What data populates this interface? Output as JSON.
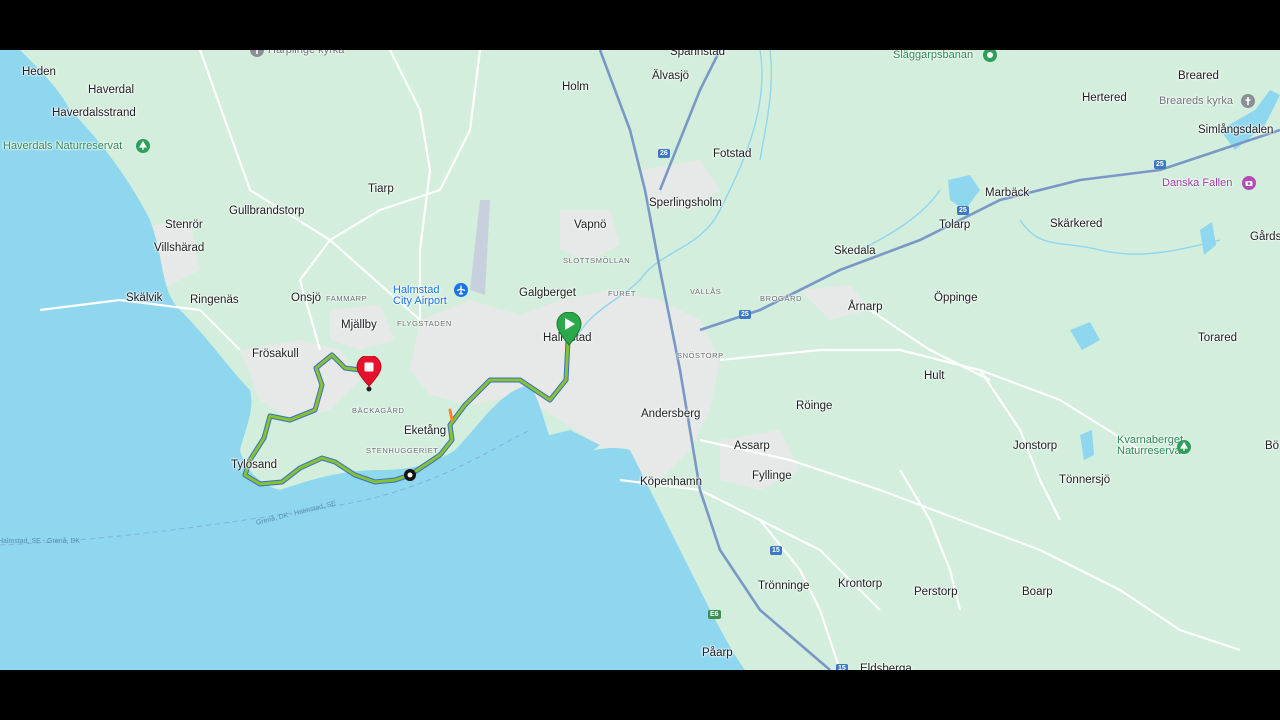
{
  "map": {
    "places": [
      {
        "id": "heden",
        "text": "Heden"
      },
      {
        "id": "haverdal",
        "text": "Haverdal"
      },
      {
        "id": "haverdalsstrand",
        "text": "Haverdalsstrand"
      },
      {
        "id": "tiarp",
        "text": "Tiarp"
      },
      {
        "id": "gullbrandstorp",
        "text": "Gullbrandstorp"
      },
      {
        "id": "stenror",
        "text": "Stenrör"
      },
      {
        "id": "villsharad",
        "text": "Villshärad"
      },
      {
        "id": "skalvik",
        "text": "Skälvik"
      },
      {
        "id": "ringenas",
        "text": "Ringenäs"
      },
      {
        "id": "onsjo",
        "text": "Onsjö"
      },
      {
        "id": "mjallby",
        "text": "Mjällby"
      },
      {
        "id": "frosakull",
        "text": "Frösakull"
      },
      {
        "id": "tylosand",
        "text": "Tylösand"
      },
      {
        "id": "eketang",
        "text": "Eketång"
      },
      {
        "id": "holm",
        "text": "Holm"
      },
      {
        "id": "alvasjo",
        "text": "Älvasjö"
      },
      {
        "id": "spannstad",
        "text": "Spannstad"
      },
      {
        "id": "fotstad",
        "text": "Fotstad"
      },
      {
        "id": "sperlingsholm",
        "text": "Sperlingsholm"
      },
      {
        "id": "vapno",
        "text": "Vapnö"
      },
      {
        "id": "galgberget",
        "text": "Galgberget"
      },
      {
        "id": "halmstad",
        "text": "Halmstad"
      },
      {
        "id": "andersberg",
        "text": "Andersberg"
      },
      {
        "id": "assarp",
        "text": "Assarp"
      },
      {
        "id": "fyllinge",
        "text": "Fyllinge"
      },
      {
        "id": "kopenhamn",
        "text": "Köpenhamn"
      },
      {
        "id": "roinge",
        "text": "Röinge"
      },
      {
        "id": "arnarp",
        "text": "Årnarp"
      },
      {
        "id": "skedala",
        "text": "Skedala"
      },
      {
        "id": "tolarp",
        "text": "Tolarp"
      },
      {
        "id": "marback",
        "text": "Marbäck"
      },
      {
        "id": "skarkered",
        "text": "Skärkered"
      },
      {
        "id": "oppinge",
        "text": "Öppinge"
      },
      {
        "id": "hult",
        "text": "Hult"
      },
      {
        "id": "torared",
        "text": "Torared"
      },
      {
        "id": "jonstorp",
        "text": "Jonstorp"
      },
      {
        "id": "tonnersjo",
        "text": "Tönnersjö"
      },
      {
        "id": "boarp",
        "text": "Boarp"
      },
      {
        "id": "perstorp",
        "text": "Perstorp"
      },
      {
        "id": "krontorp",
        "text": "Krontorp"
      },
      {
        "id": "tronninge",
        "text": "Trönninge"
      },
      {
        "id": "paarp",
        "text": "Påarp"
      },
      {
        "id": "eldsberga",
        "text": "Eldsberga"
      },
      {
        "id": "breared",
        "text": "Breared"
      },
      {
        "id": "hertered",
        "text": "Hertered"
      },
      {
        "id": "simlangsdalen",
        "text": "Simlångsdalen"
      },
      {
        "id": "gards",
        "text": "Gårds"
      },
      {
        "id": "bo",
        "text": "Bö"
      }
    ],
    "districts": [
      {
        "id": "fammarp",
        "text": "FAMMARP"
      },
      {
        "id": "flygstaden",
        "text": "FLYGSTADEN"
      },
      {
        "id": "slottsmollan",
        "text": "SLOTTSMÖLLAN"
      },
      {
        "id": "furet",
        "text": "FURET"
      },
      {
        "id": "vallas",
        "text": "VALLÅS"
      },
      {
        "id": "brogard",
        "text": "BROGÅRD"
      },
      {
        "id": "snostorp",
        "text": "SNÖSTORP"
      },
      {
        "id": "backagard",
        "text": "BÄCKAGÅRD"
      },
      {
        "id": "stenhuggeriet",
        "text": "STENHUGGERIET"
      }
    ],
    "pois": [
      {
        "id": "harplinge",
        "text": "Harplinge kyrka",
        "icon": "church-icon"
      },
      {
        "id": "haverdals-nr",
        "text": "Haverdals Naturreservat",
        "icon": "tree-icon"
      },
      {
        "id": "airport",
        "text": "Halmstad\nCity Airport",
        "icon": "airplane-icon"
      },
      {
        "id": "slaggarp",
        "text": "Släggarpsbanan",
        "icon": "sports-icon"
      },
      {
        "id": "breareds-kyrka",
        "text": "Breareds kyrka",
        "icon": "church-icon"
      },
      {
        "id": "danska-fallen",
        "text": "Danska Fallen",
        "icon": "camera-icon"
      },
      {
        "id": "kvarnaberget",
        "text": "Kvarnaberget\nNaturreservat",
        "icon": "tree-icon"
      }
    ],
    "roads": [
      {
        "id": "r26a",
        "text": "26"
      },
      {
        "id": "r25a",
        "text": "25"
      },
      {
        "id": "r25b",
        "text": "25"
      },
      {
        "id": "r25c",
        "text": "25"
      },
      {
        "id": "r15",
        "text": "15"
      },
      {
        "id": "e6",
        "text": "E6"
      },
      {
        "id": "r15b",
        "text": "15"
      }
    ],
    "ferry": [
      {
        "id": "ferry1",
        "text": "Grenå, DK - Halmstad, SE"
      },
      {
        "id": "ferry2",
        "text": "Halmstad, SE - Grenå, DK"
      }
    ],
    "colors": {
      "land": "#d3eedc",
      "water": "#8fd6ef",
      "urban": "#e8ebe9",
      "route_green": "#86c232",
      "route_blue": "#4a79c8",
      "start_marker": "#2aa84a",
      "end_marker": "#e8112d"
    }
  }
}
